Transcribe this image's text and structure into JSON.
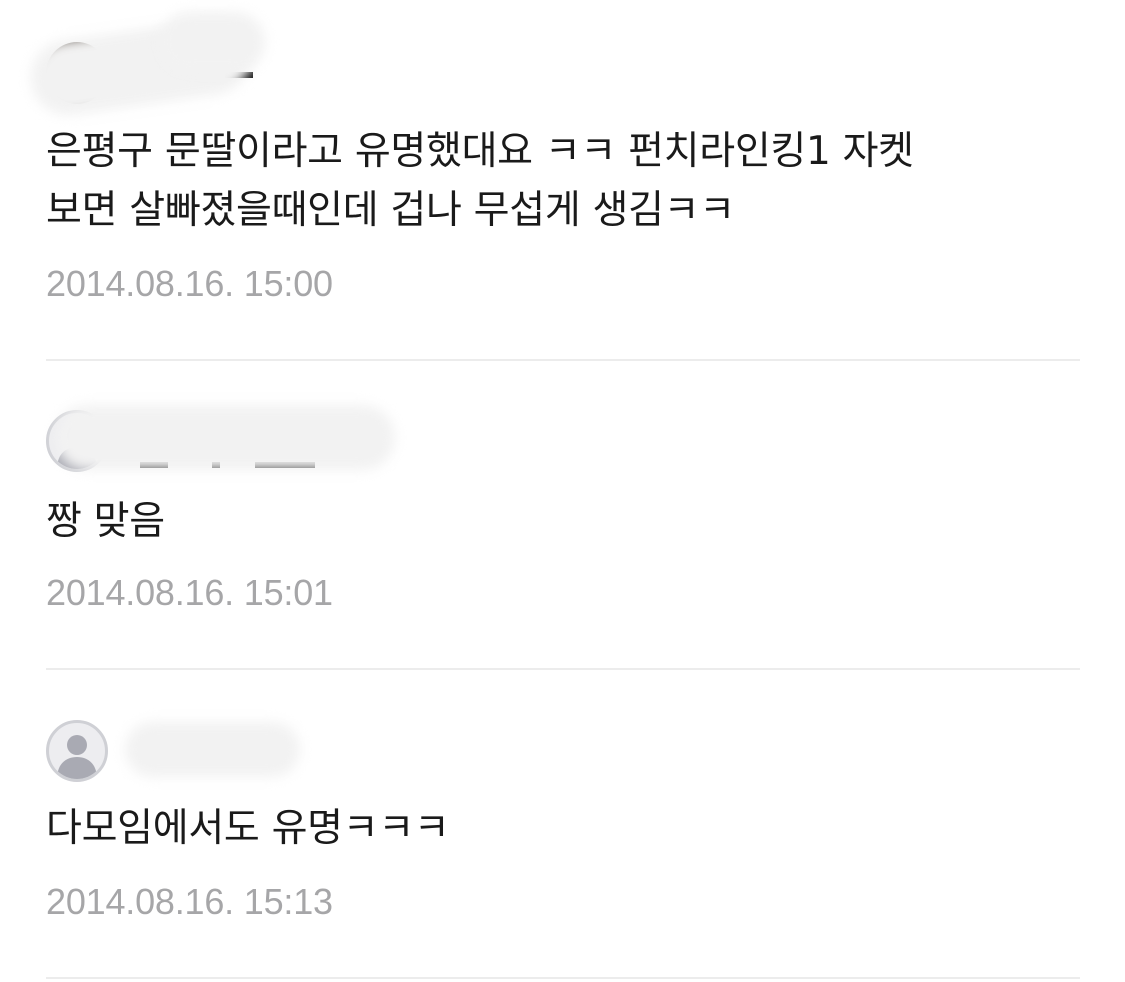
{
  "comments": [
    {
      "avatar": "profile-photo",
      "text_lines": [
        "은평구 문딸이라고 유명했대요 ㅋㅋ 펀치라인킹1 자켓",
        "보면 살빠졌을때인데 겁나 무섭게 생김ㅋㅋ"
      ],
      "timestamp": "2014.08.16. 15:00"
    },
    {
      "avatar": "default-user-icon",
      "text_lines": [
        "짱 맞음"
      ],
      "timestamp": "2014.08.16. 15:01"
    },
    {
      "avatar": "default-user-icon",
      "text_lines": [
        "다모임에서도 유명ㅋㅋㅋ"
      ],
      "timestamp": "2014.08.16. 15:13"
    }
  ]
}
